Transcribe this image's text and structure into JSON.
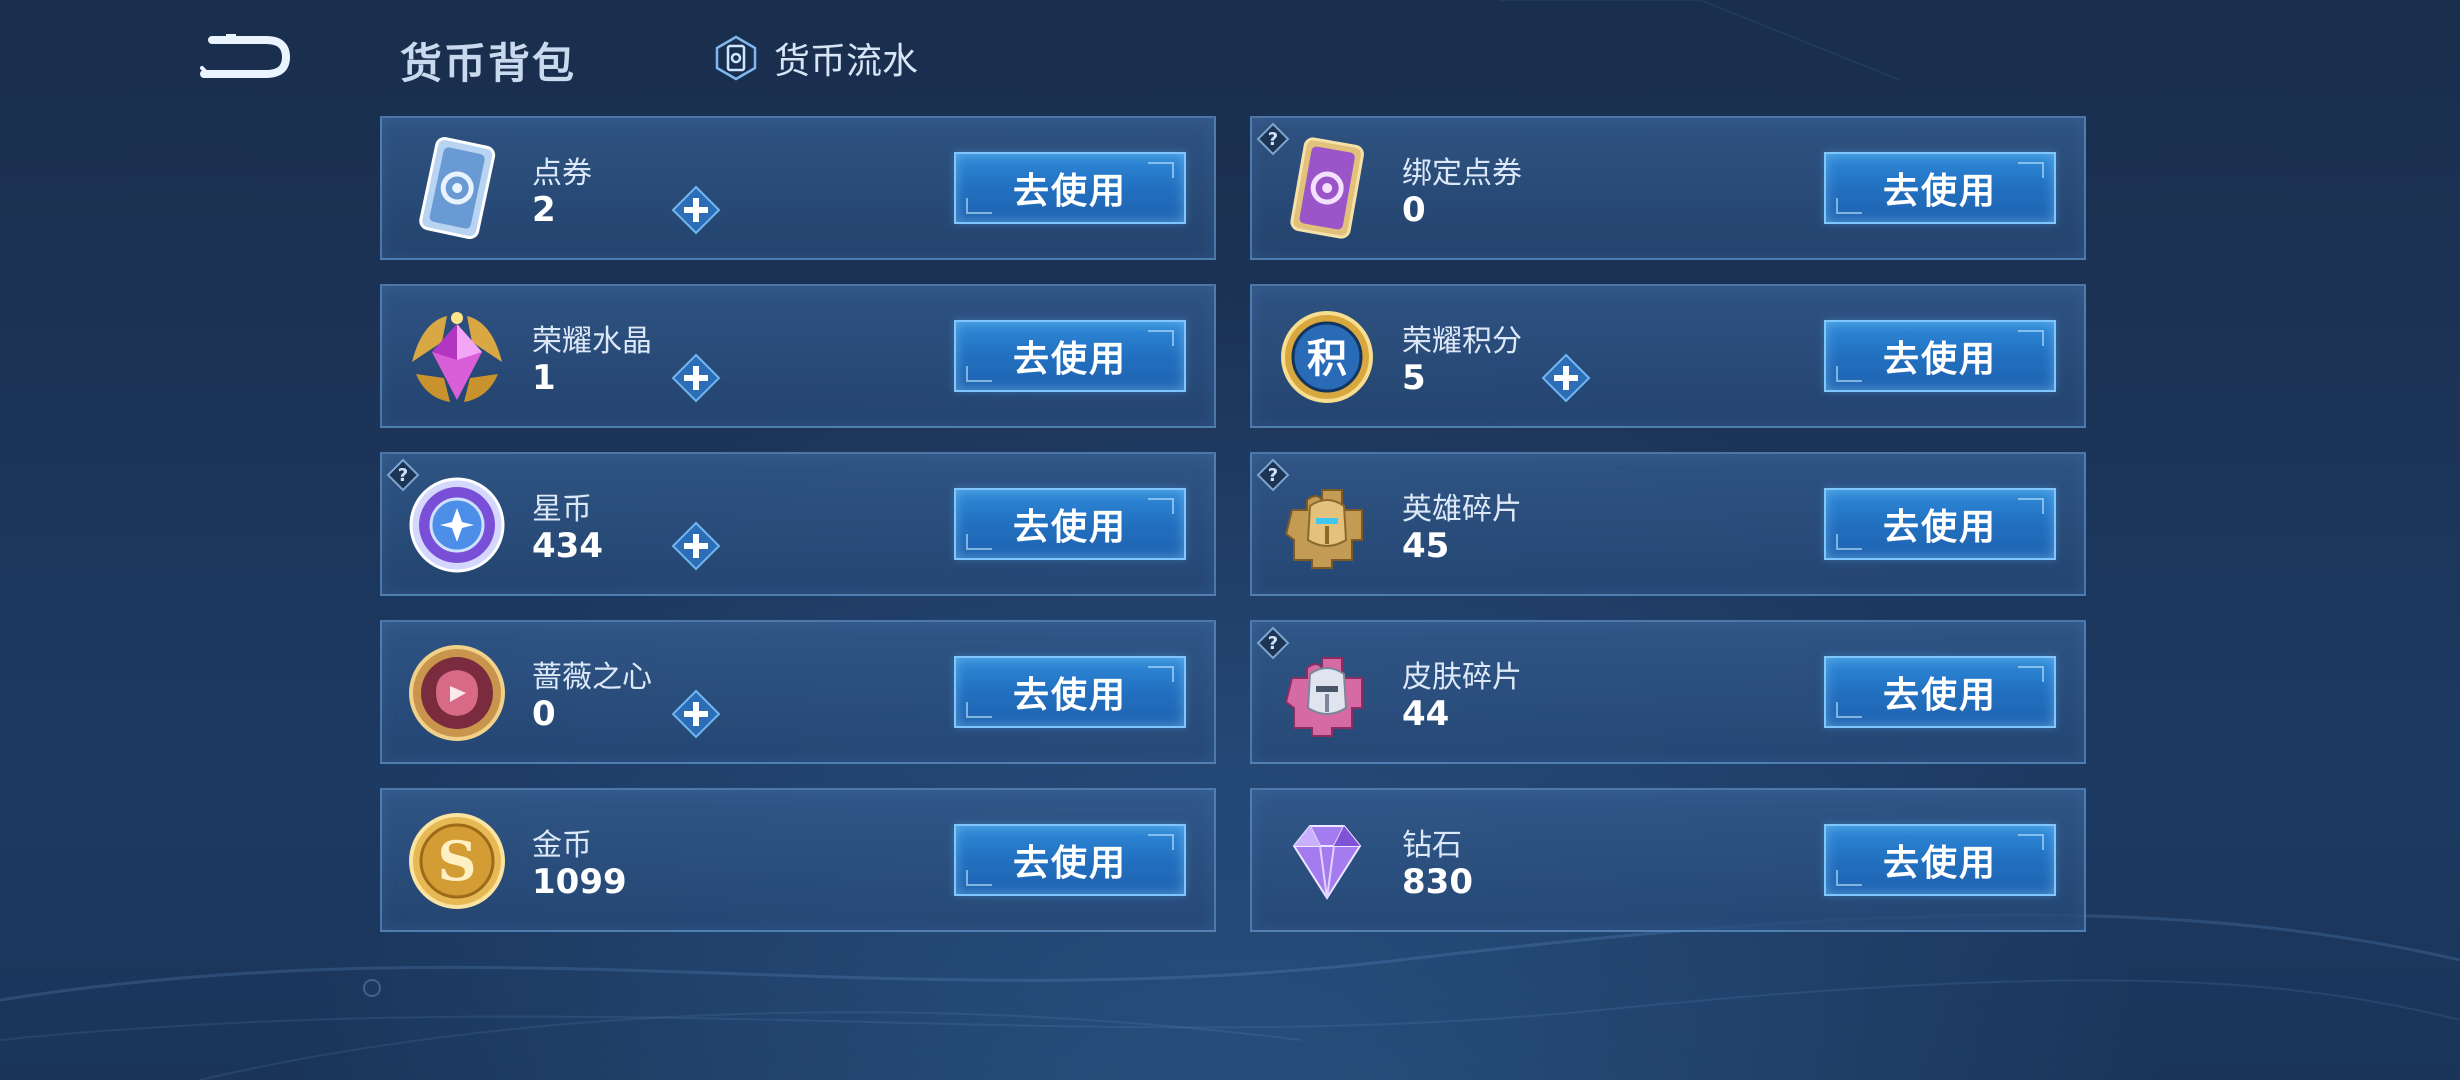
{
  "header": {
    "title": "货币背包",
    "flow_tab_label": "货币流水"
  },
  "colors": {
    "accent": "#2f8ad8",
    "button_border": "#7fc6ff",
    "background": "#1c3458"
  },
  "cards": [
    {
      "name": "点券",
      "amount": "2",
      "button": "去使用",
      "icon": "ticket-blue-icon",
      "has_plus": true,
      "has_help": false
    },
    {
      "name": "绑定点券",
      "amount": "0",
      "button": "去使用",
      "icon": "ticket-purple-icon",
      "has_plus": false,
      "has_help": true
    },
    {
      "name": "荣耀水晶",
      "amount": "1",
      "button": "去使用",
      "icon": "crystal-icon",
      "has_plus": true,
      "has_help": false
    },
    {
      "name": "荣耀积分",
      "amount": "5",
      "button": "去使用",
      "icon": "points-icon",
      "has_plus": true,
      "has_help": false
    },
    {
      "name": "星币",
      "amount": "434",
      "button": "去使用",
      "icon": "star-coin-icon",
      "has_plus": true,
      "has_help": true
    },
    {
      "name": "英雄碎片",
      "amount": "45",
      "button": "去使用",
      "icon": "hero-fragment-icon",
      "has_plus": false,
      "has_help": true
    },
    {
      "name": "蔷薇之心",
      "amount": "0",
      "button": "去使用",
      "icon": "rose-heart-icon",
      "has_plus": true,
      "has_help": false
    },
    {
      "name": "皮肤碎片",
      "amount": "44",
      "button": "去使用",
      "icon": "skin-fragment-icon",
      "has_plus": false,
      "has_help": true
    },
    {
      "name": "金币",
      "amount": "1099",
      "button": "去使用",
      "icon": "gold-coin-icon",
      "has_plus": false,
      "has_help": false
    },
    {
      "name": "钻石",
      "amount": "830",
      "button": "去使用",
      "icon": "diamond-icon",
      "has_plus": false,
      "has_help": false
    }
  ]
}
